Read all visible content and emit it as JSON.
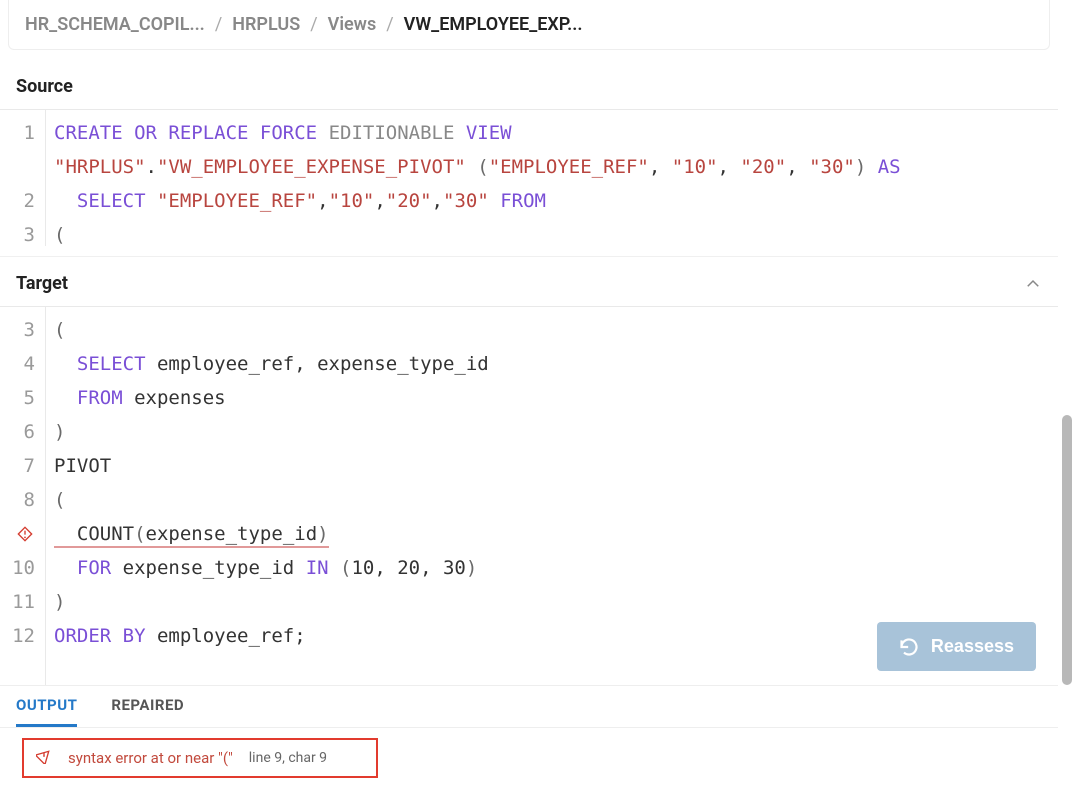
{
  "breadcrumb": {
    "items": [
      "HR_SCHEMA_COPIL...",
      "HRPLUS",
      "Views",
      "VW_EMPLOYEE_EXP..."
    ]
  },
  "sections": {
    "source_title": "Source",
    "target_title": "Target"
  },
  "source_code": {
    "lines": [
      {
        "n": "1",
        "tokens": [
          {
            "t": "CREATE OR REPLACE FORCE",
            "c": "kw-purple"
          },
          {
            "t": " ",
            "c": ""
          },
          {
            "t": "EDITIONABLE",
            "c": "kw-gray"
          },
          {
            "t": " ",
            "c": ""
          },
          {
            "t": "VIEW",
            "c": "kw-purple"
          }
        ]
      },
      {
        "n": "",
        "tokens": [
          {
            "t": "\"HRPLUS\"",
            "c": "str-red"
          },
          {
            "t": ".",
            "c": "ident"
          },
          {
            "t": "\"VW_EMPLOYEE_EXPENSE_PIVOT\"",
            "c": "str-red"
          },
          {
            "t": " (",
            "c": "paren"
          },
          {
            "t": "\"EMPLOYEE_REF\"",
            "c": "str-red"
          },
          {
            "t": ", ",
            "c": "ident"
          },
          {
            "t": "\"10\"",
            "c": "str-red"
          },
          {
            "t": ", ",
            "c": "ident"
          },
          {
            "t": "\"20\"",
            "c": "str-red"
          },
          {
            "t": ", ",
            "c": "ident"
          },
          {
            "t": "\"30\"",
            "c": "str-red"
          },
          {
            "t": ") ",
            "c": "paren"
          },
          {
            "t": "AS",
            "c": "kw-purple"
          }
        ]
      },
      {
        "n": "2",
        "tokens": [
          {
            "t": "  SELECT ",
            "c": "kw-purple"
          },
          {
            "t": "\"EMPLOYEE_REF\"",
            "c": "str-red"
          },
          {
            "t": ",",
            "c": "ident"
          },
          {
            "t": "\"10\"",
            "c": "str-red"
          },
          {
            "t": ",",
            "c": "ident"
          },
          {
            "t": "\"20\"",
            "c": "str-red"
          },
          {
            "t": ",",
            "c": "ident"
          },
          {
            "t": "\"30\"",
            "c": "str-red"
          },
          {
            "t": " ",
            "c": ""
          },
          {
            "t": "FROM",
            "c": "kw-purple"
          }
        ]
      },
      {
        "n": "3",
        "tokens": [
          {
            "t": "(",
            "c": "paren"
          }
        ]
      }
    ]
  },
  "target_code": {
    "lines": [
      {
        "n": "3",
        "err": false,
        "tokens": [
          {
            "t": "(",
            "c": "paren"
          }
        ]
      },
      {
        "n": "4",
        "err": false,
        "tokens": [
          {
            "t": "  ",
            "c": ""
          },
          {
            "t": "SELECT",
            "c": "kw-purple"
          },
          {
            "t": " employee_ref, expense_type_id",
            "c": "ident"
          }
        ]
      },
      {
        "n": "5",
        "err": false,
        "tokens": [
          {
            "t": "  ",
            "c": ""
          },
          {
            "t": "FROM",
            "c": "kw-purple"
          },
          {
            "t": " expenses",
            "c": "ident"
          }
        ]
      },
      {
        "n": "6",
        "err": false,
        "tokens": [
          {
            "t": ")",
            "c": "paren"
          }
        ]
      },
      {
        "n": "7",
        "err": false,
        "tokens": [
          {
            "t": "PIVOT",
            "c": "ident"
          }
        ]
      },
      {
        "n": "8",
        "err": false,
        "tokens": [
          {
            "t": "(",
            "c": "paren"
          }
        ]
      },
      {
        "n": "9",
        "err": true,
        "underline": true,
        "tokens": [
          {
            "t": "  ",
            "c": ""
          },
          {
            "t": "COUNT",
            "c": "ident"
          },
          {
            "t": "(",
            "c": "paren"
          },
          {
            "t": "expense_type_id",
            "c": "ident"
          },
          {
            "t": ")",
            "c": "paren"
          }
        ]
      },
      {
        "n": "10",
        "err": false,
        "tokens": [
          {
            "t": "  ",
            "c": ""
          },
          {
            "t": "FOR",
            "c": "kw-purple"
          },
          {
            "t": " expense_type_id ",
            "c": "ident"
          },
          {
            "t": "IN",
            "c": "kw-purple"
          },
          {
            "t": " (",
            "c": "paren"
          },
          {
            "t": "10, 20, 30",
            "c": "num"
          },
          {
            "t": ")",
            "c": "paren"
          }
        ]
      },
      {
        "n": "11",
        "err": false,
        "tokens": [
          {
            "t": ")",
            "c": "paren"
          }
        ]
      },
      {
        "n": "12",
        "err": false,
        "tokens": [
          {
            "t": "ORDER BY",
            "c": "kw-purple"
          },
          {
            "t": " employee_ref",
            "c": "ident"
          },
          {
            "t": ";",
            "c": "semic"
          }
        ]
      }
    ]
  },
  "reassess": {
    "label": "Reassess"
  },
  "tabs": {
    "output": "OUTPUT",
    "repaired": "REPAIRED"
  },
  "error": {
    "message": "syntax error at or near \"(\"",
    "location": "line 9, char 9"
  }
}
